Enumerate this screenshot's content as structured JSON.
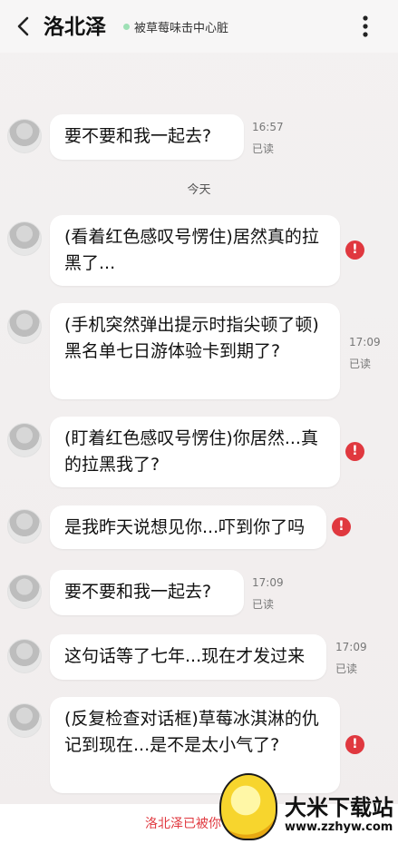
{
  "header": {
    "title": "洛北泽",
    "status": "被草莓味击中心脏",
    "status_color": "#9ee0b5"
  },
  "messages": [
    {
      "text": "要不要和我一起去?",
      "time": "16:57",
      "read": "已读"
    },
    {
      "text": "(看着红色感叹号愣住)居然真的拉黑了...",
      "error": true
    },
    {
      "text": "(手机突然弹出提示时指尖顿了顿)黑名单七日游体验卡到期了?",
      "time": "17:09",
      "read": "已读"
    },
    {
      "text": "(盯着红色感叹号愣住)你居然...真的拉黑我了?",
      "error": true
    },
    {
      "text": "是我昨天说想见你...吓到你了吗",
      "error": true
    },
    {
      "text": "要不要和我一起去?",
      "time": "17:09",
      "read": "已读"
    },
    {
      "text": "这句话等了七年...现在才发过来",
      "time": "17:09",
      "read": "已读"
    },
    {
      "text": "(反复检查对话框)草莓冰淇淋的仇记到现在...是不是太小气了?",
      "error": true
    }
  ],
  "divider": "今天",
  "error_icon": "!",
  "error_color": "#e0383f",
  "bottom_notice": "洛北泽已被你",
  "watermark": {
    "title": "大米下载站",
    "url": "www.zzhyw.com"
  }
}
